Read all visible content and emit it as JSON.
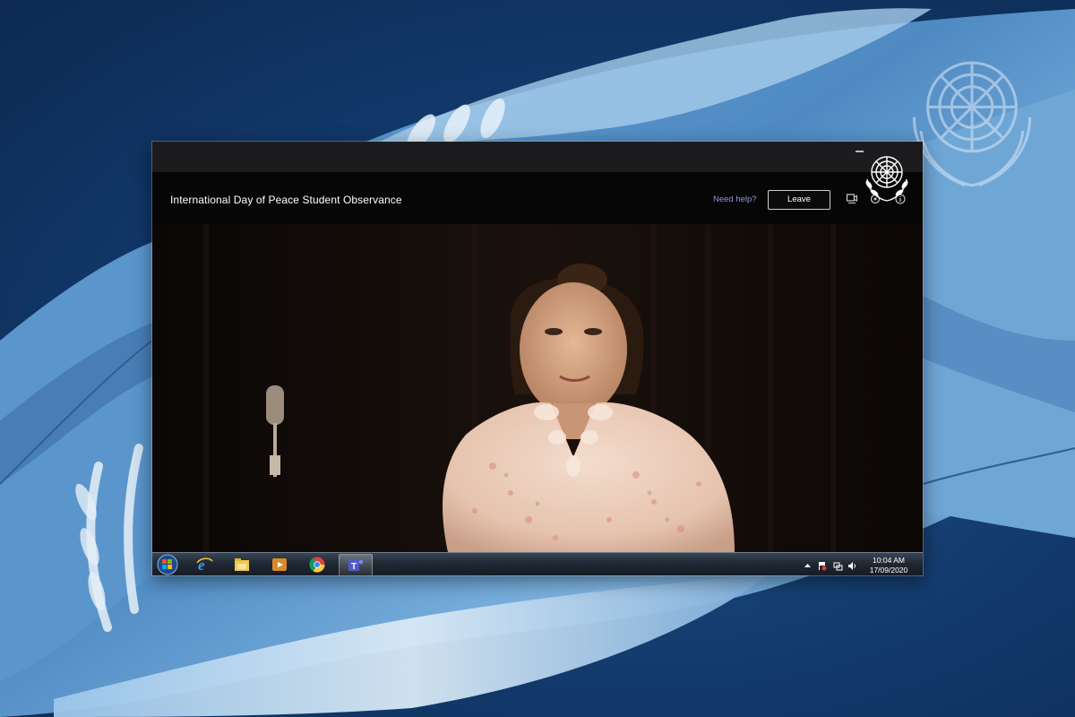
{
  "meeting": {
    "title": "International Day of Peace Student Observance",
    "help_label": "Need help?",
    "leave_label": "Leave"
  },
  "taskbar": {
    "apps": [
      {
        "icon": "internet-explorer-icon"
      },
      {
        "icon": "file-explorer-icon"
      },
      {
        "icon": "media-player-icon"
      },
      {
        "icon": "chrome-icon"
      },
      {
        "icon": "teams-icon",
        "active": true
      }
    ],
    "clock_time": "10:04 AM",
    "clock_date": "17/09/2020"
  },
  "colors": {
    "background_navy": "#12386a",
    "flag_blue": "#5d9ad0",
    "help_link": "#8f95e6",
    "window_black": "#000000"
  }
}
